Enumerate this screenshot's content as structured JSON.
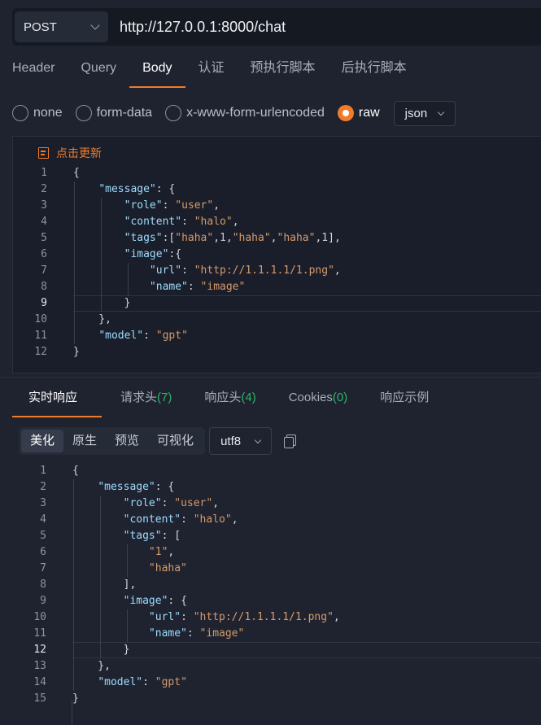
{
  "request": {
    "method": "POST",
    "url": "http://127.0.0.1:8000/chat"
  },
  "tabs": [
    "Header",
    "Query",
    "Body",
    "认证",
    "预执行脚本",
    "后执行脚本"
  ],
  "active_tab": "Body",
  "body_types": [
    "none",
    "form-data",
    "x-www-form-urlencoded",
    "raw"
  ],
  "active_body_type": "raw",
  "format": "json",
  "refresh_label": "点击更新",
  "request_body_lines": [
    "{",
    "    \"message\": {",
    "        \"role\": \"user\",",
    "        \"content\": \"halo\",",
    "        \"tags\":[\"haha\",1,\"haha\",\"haha\",1],",
    "        \"image\":{",
    "            \"url\": \"http://1.1.1.1/1.png\",",
    "            \"name\": \"image\"",
    "        }",
    "    },",
    "    \"model\": \"gpt\"",
    "}"
  ],
  "request_current_line": 9,
  "response_tabs": [
    {
      "label": "实时响应",
      "count": ""
    },
    {
      "label": "请求头",
      "count": "(7)"
    },
    {
      "label": "响应头",
      "count": "(4)"
    },
    {
      "label": "Cookies",
      "count": "(0)"
    },
    {
      "label": "响应示例",
      "count": ""
    }
  ],
  "view_modes": [
    "美化",
    "原生",
    "预览",
    "可视化"
  ],
  "active_view_mode": "美化",
  "encoding": "utf8",
  "response_body_lines": [
    "{",
    "    \"message\": {",
    "        \"role\": \"user\",",
    "        \"content\": \"halo\",",
    "        \"tags\": [",
    "            \"1\",",
    "            \"haha\"",
    "        ],",
    "        \"image\": {",
    "            \"url\": \"http://1.1.1.1/1.png\",",
    "            \"name\": \"image\"",
    "        }",
    "    },",
    "    \"model\": \"gpt\"",
    "}"
  ],
  "response_current_line": 12,
  "colors": {
    "accent": "#f07c2a",
    "count": "#2fb36b",
    "key": "#9cdcfe",
    "string": "#d69a6a"
  }
}
